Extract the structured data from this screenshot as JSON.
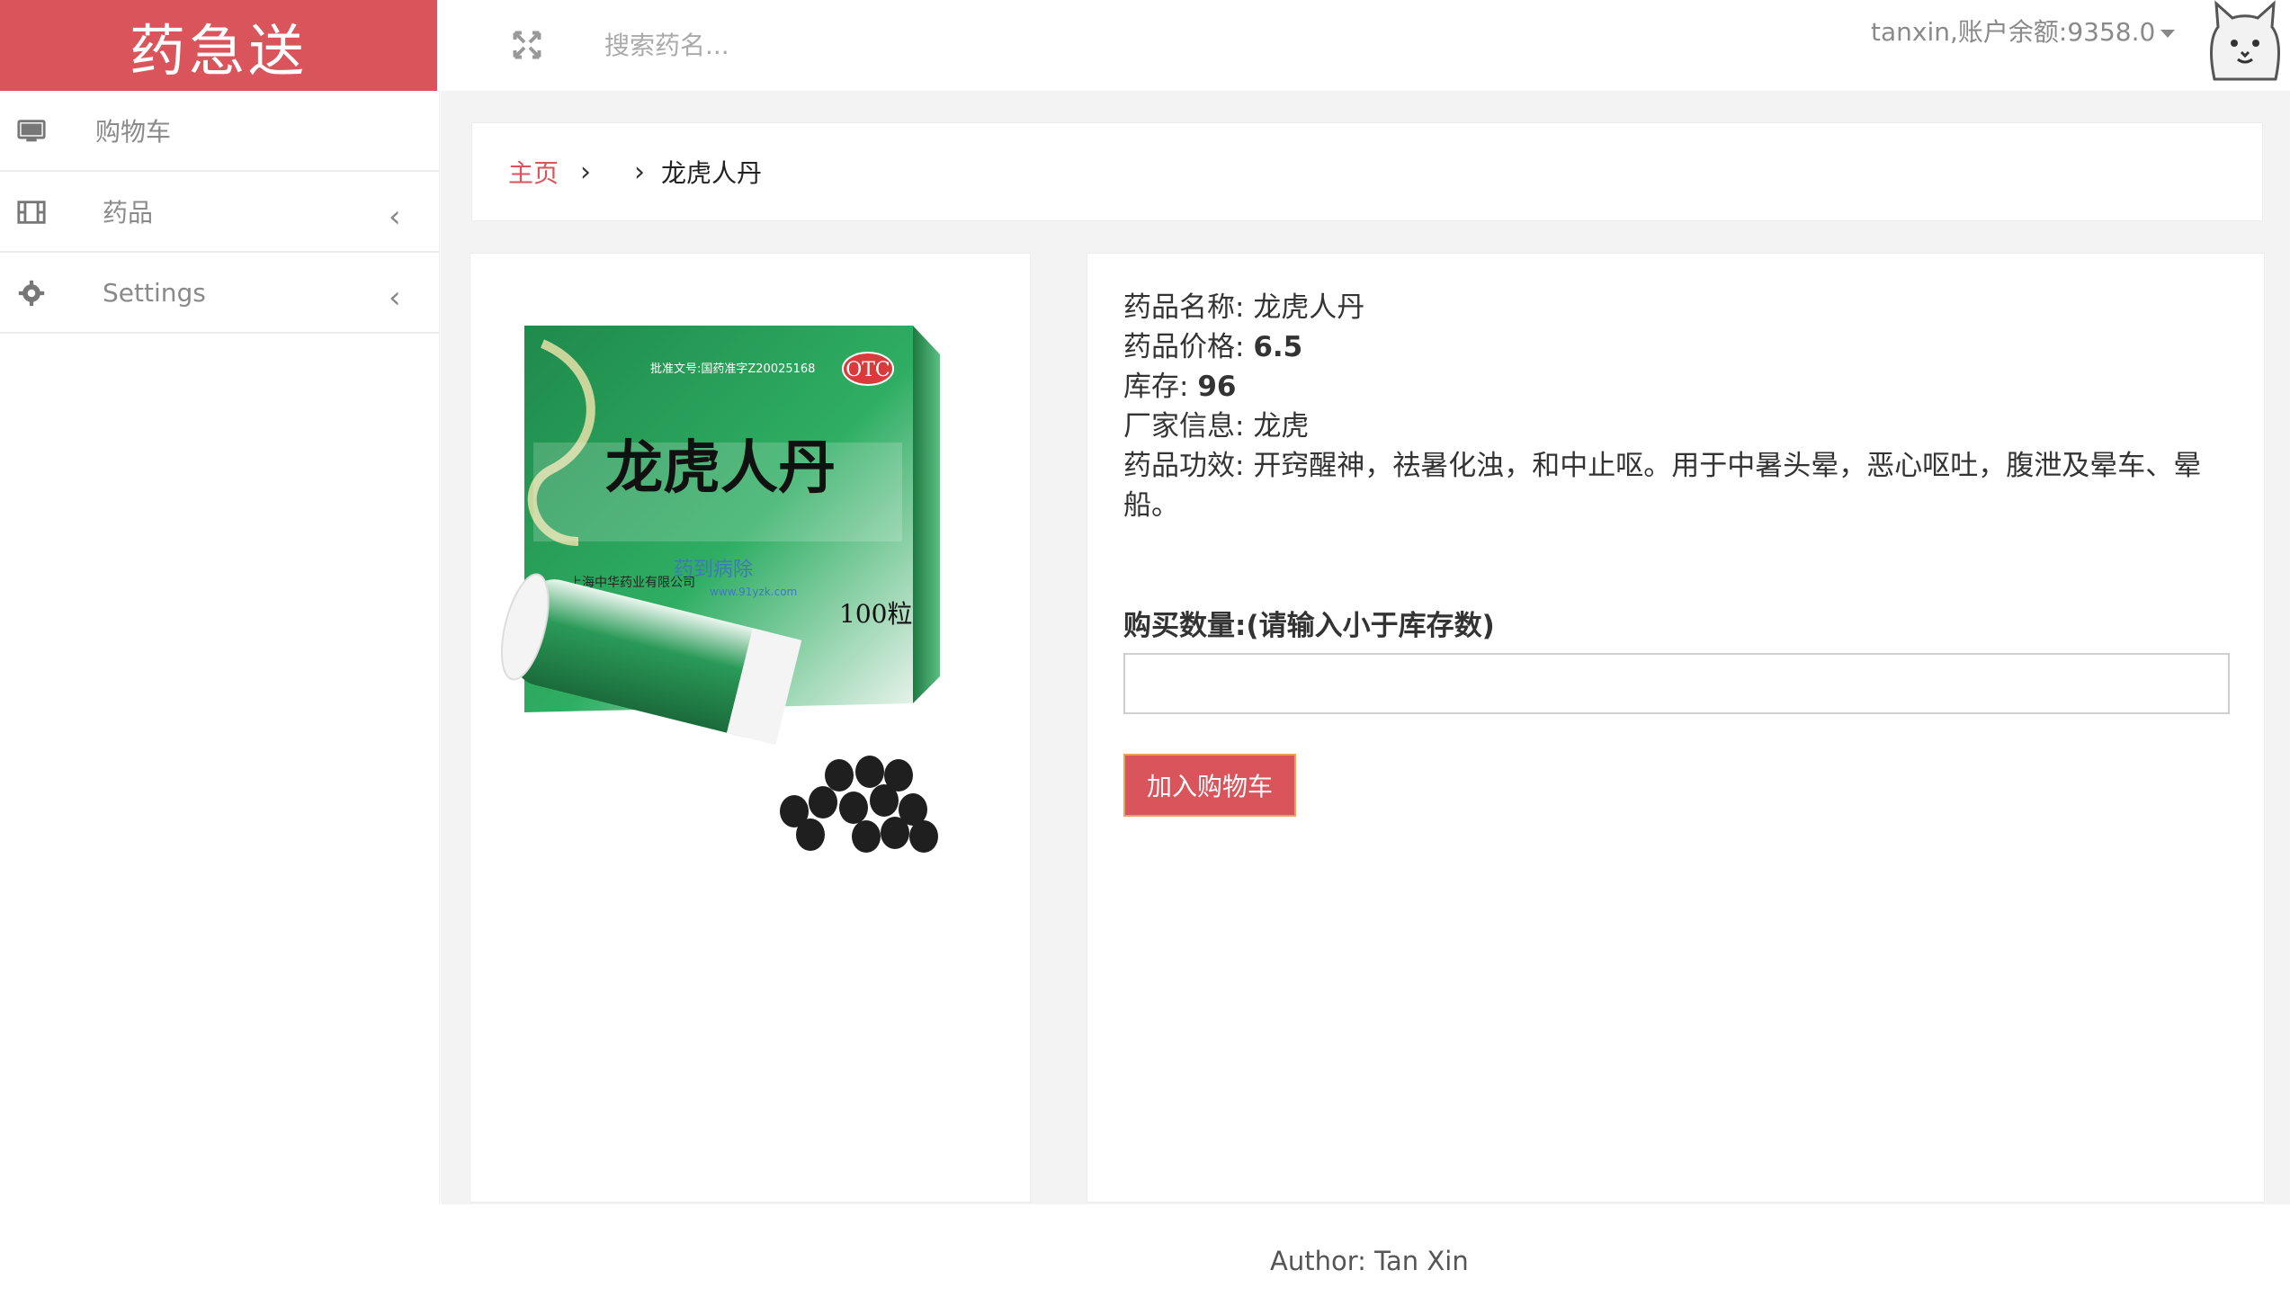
{
  "brand": {
    "title": "药急送"
  },
  "sidebar": {
    "items": [
      {
        "label": "购物车",
        "icon": "monitor-icon",
        "has_chevron": false
      },
      {
        "label": "药品",
        "icon": "film-icon",
        "has_chevron": true
      },
      {
        "label": "Settings",
        "icon": "gear-icon",
        "has_chevron": true
      }
    ],
    "chevron": "‹"
  },
  "topbar": {
    "expand_icon": "expand-icon",
    "search_placeholder": "搜索药名...",
    "user_text": "tanxin,账户余额:9358.0",
    "avatar_icon": "cat-avatar-icon"
  },
  "breadcrumb": {
    "home": "主页",
    "separator": "›",
    "current": "龙虎人丹"
  },
  "product": {
    "image_alt": "龙虎人丹",
    "box": {
      "title": "龙虎人丹",
      "approval": "批准文号:国药准字Z20025168",
      "otc": "OTC",
      "maker": "上海中华药业有限公司",
      "count": "100粒",
      "watermark": "药到病除",
      "watermark_url": "www.91yzk.com"
    },
    "name_label": "药品名称:",
    "name_value": "龙虎人丹",
    "price_label": "药品价格:",
    "price_value": "6.5",
    "stock_label": "库存:",
    "stock_value": "96",
    "maker_label": "厂家信息:",
    "maker_value": "龙虎",
    "effect_label": "药品功效:",
    "effect_value": "开窍醒神，祛暑化浊，和中止呕。用于中暑头晕，恶心呕吐，腹泄及晕车、晕船。"
  },
  "purchase": {
    "qty_label": "购买数量:(请输入小于库存数)",
    "qty_value": "",
    "add_button": "加入购物车"
  },
  "footer": {
    "text": "Author: Tan Xin"
  },
  "colors": {
    "accent": "#d9545b",
    "button_border": "#e8a45a",
    "content_bg": "#f3f3f3"
  }
}
